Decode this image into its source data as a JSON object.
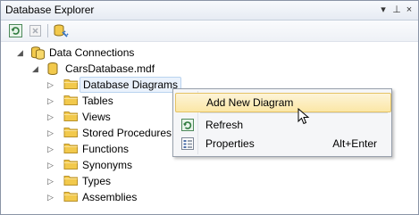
{
  "window": {
    "title": "Database Explorer"
  },
  "title_controls": {
    "dropdown": "▾",
    "pin": "⊥",
    "close": "×"
  },
  "toolbar": {
    "refresh_icon": "refresh-icon",
    "stop_icon": "stop-icon",
    "connect_icon": "connect-to-database-icon"
  },
  "tree": {
    "root": {
      "label": "Data Connections",
      "expander": "◢"
    },
    "database": {
      "label": "CarsDatabase.mdf",
      "expander": "◢"
    },
    "folders": [
      {
        "label": "Database Diagrams",
        "expander": "▷",
        "selected": true
      },
      {
        "label": "Tables",
        "expander": "▷"
      },
      {
        "label": "Views",
        "expander": "▷"
      },
      {
        "label": "Stored Procedures",
        "expander": "▷"
      },
      {
        "label": "Functions",
        "expander": "▷"
      },
      {
        "label": "Synonyms",
        "expander": "▷"
      },
      {
        "label": "Types",
        "expander": "▷"
      },
      {
        "label": "Assemblies",
        "expander": "▷"
      }
    ]
  },
  "context_menu": {
    "items": [
      {
        "label": "Add New Diagram",
        "shortcut": "",
        "highlighted": true
      },
      {
        "label": "Refresh",
        "shortcut": ""
      },
      {
        "label": "Properties",
        "shortcut": "Alt+Enter"
      }
    ]
  },
  "colors": {
    "highlight": "#fbe7a6",
    "selection": "#eaf2fc",
    "folder": "#f2c94c"
  }
}
